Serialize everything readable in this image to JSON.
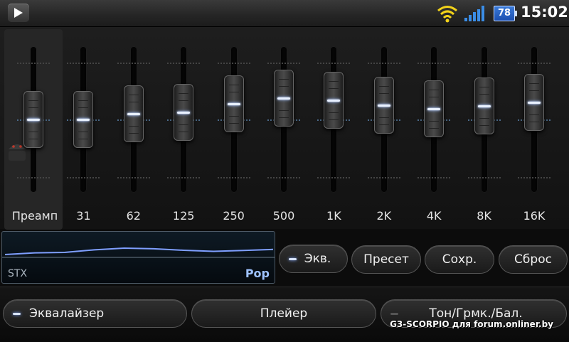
{
  "status": {
    "battery": "78",
    "time": "15:02"
  },
  "equalizer": {
    "bands": [
      {
        "label": "Преамп",
        "level": 0.0
      },
      {
        "label": "31",
        "level": 0.0
      },
      {
        "label": "62",
        "level": 0.08
      },
      {
        "label": "125",
        "level": 0.1
      },
      {
        "label": "250",
        "level": 0.22
      },
      {
        "label": "500",
        "level": 0.3
      },
      {
        "label": "1K",
        "level": 0.27
      },
      {
        "label": "2K",
        "level": 0.2
      },
      {
        "label": "4K",
        "level": 0.15
      },
      {
        "label": "8K",
        "level": 0.19
      },
      {
        "label": "16K",
        "level": 0.24
      }
    ]
  },
  "curve": {
    "left_label": "STX",
    "preset_name": "Pop"
  },
  "actions": {
    "eq_toggle": "Экв.",
    "preset": "Пресет",
    "save": "Сохр.",
    "reset": "Сброс"
  },
  "tabs": {
    "equalizer": "Эквалайзер",
    "player": "Плейер",
    "tone": "Тон/Грмк./Бал."
  },
  "watermark": "G3-SCORPIO для forum.onliner.by",
  "colors": {
    "accent_glow": "#dbe6ff",
    "preset_name": "#9ec2ff",
    "battery": "#2a63c8"
  }
}
